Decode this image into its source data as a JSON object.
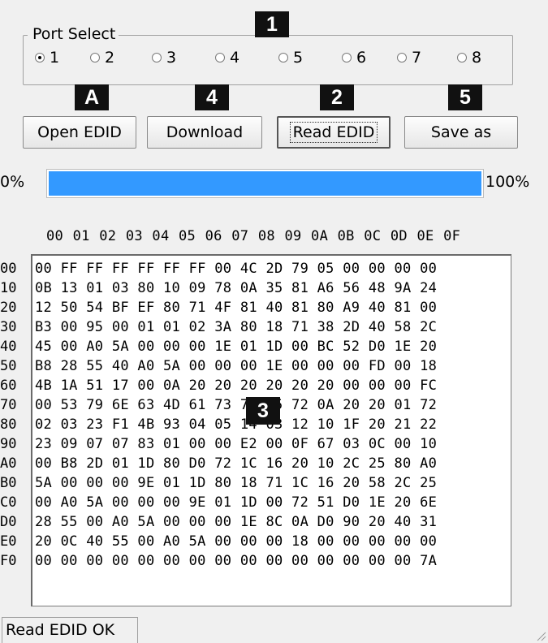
{
  "port_select": {
    "title": "Port Select",
    "options": [
      "1",
      "2",
      "3",
      "4",
      "5",
      "6",
      "7",
      "8"
    ],
    "selected": "1"
  },
  "badges": {
    "b1": "1",
    "bA": "A",
    "b4": "4",
    "b2": "2",
    "b5": "5",
    "b3": "3"
  },
  "buttons": {
    "open_edid": "Open EDID",
    "download": "Download",
    "read_edid": "Read EDID",
    "save_as": "Save as"
  },
  "progress": {
    "min_label": "0%",
    "max_label": "100%",
    "value": 1.0,
    "color": "#3399ff"
  },
  "hex": {
    "column_header": "00 01 02 03 04 05 06 07 08 09 0A 0B 0C 0D 0E 0F",
    "row_labels": [
      "00",
      "10",
      "20",
      "30",
      "40",
      "50",
      "60",
      "70",
      "80",
      "90",
      "A0",
      "B0",
      "C0",
      "D0",
      "E0",
      "F0"
    ],
    "rows": [
      "00 FF FF FF FF FF FF 00 4C 2D 79 05 00 00 00 00",
      "0B 13 01 03 80 10 09 78 0A 35 81 A6 56 48 9A 24",
      "12 50 54 BF EF 80 71 4F 81 40 81 80 A9 40 81 00",
      "B3 00 95 00 01 01 02 3A 80 18 71 38 2D 40 58 2C",
      "45 00 A0 5A 00 00 00 1E 01 1D 00 BC 52 D0 1E 20",
      "B8 28 55 40 A0 5A 00 00 00 1E 00 00 00 FD 00 18",
      "4B 1A 51 17 00 0A 20 20 20 20 20 20 00 00 00 FC",
      "00 53 79 6E 63 4D 61 73 74 65 72 0A 20 20 01 72",
      "02 03 23 F1 4B 93 04 05 14 03 12 10 1F 20 21 22",
      "23 09 07 07 83 01 00 00 E2 00 0F 67 03 0C 00 10",
      "00 B8 2D 01 1D 80 D0 72 1C 16 20 10 2C 25 80 A0",
      "5A 00 00 00 9E 01 1D 80 18 71 1C 16 20 58 2C 25",
      "00 A0 5A 00 00 00 9E 01 1D 00 72 51 D0 1E 20 6E",
      "28 55 00 A0 5A 00 00 00 1E 8C 0A D0 90 20 40 31",
      "20 0C 40 55 00 A0 5A 00 00 00 18 00 00 00 00 00",
      "00 00 00 00 00 00 00 00 00 00 00 00 00 00 00 7A"
    ]
  },
  "status": {
    "text": "Read EDID OK"
  }
}
